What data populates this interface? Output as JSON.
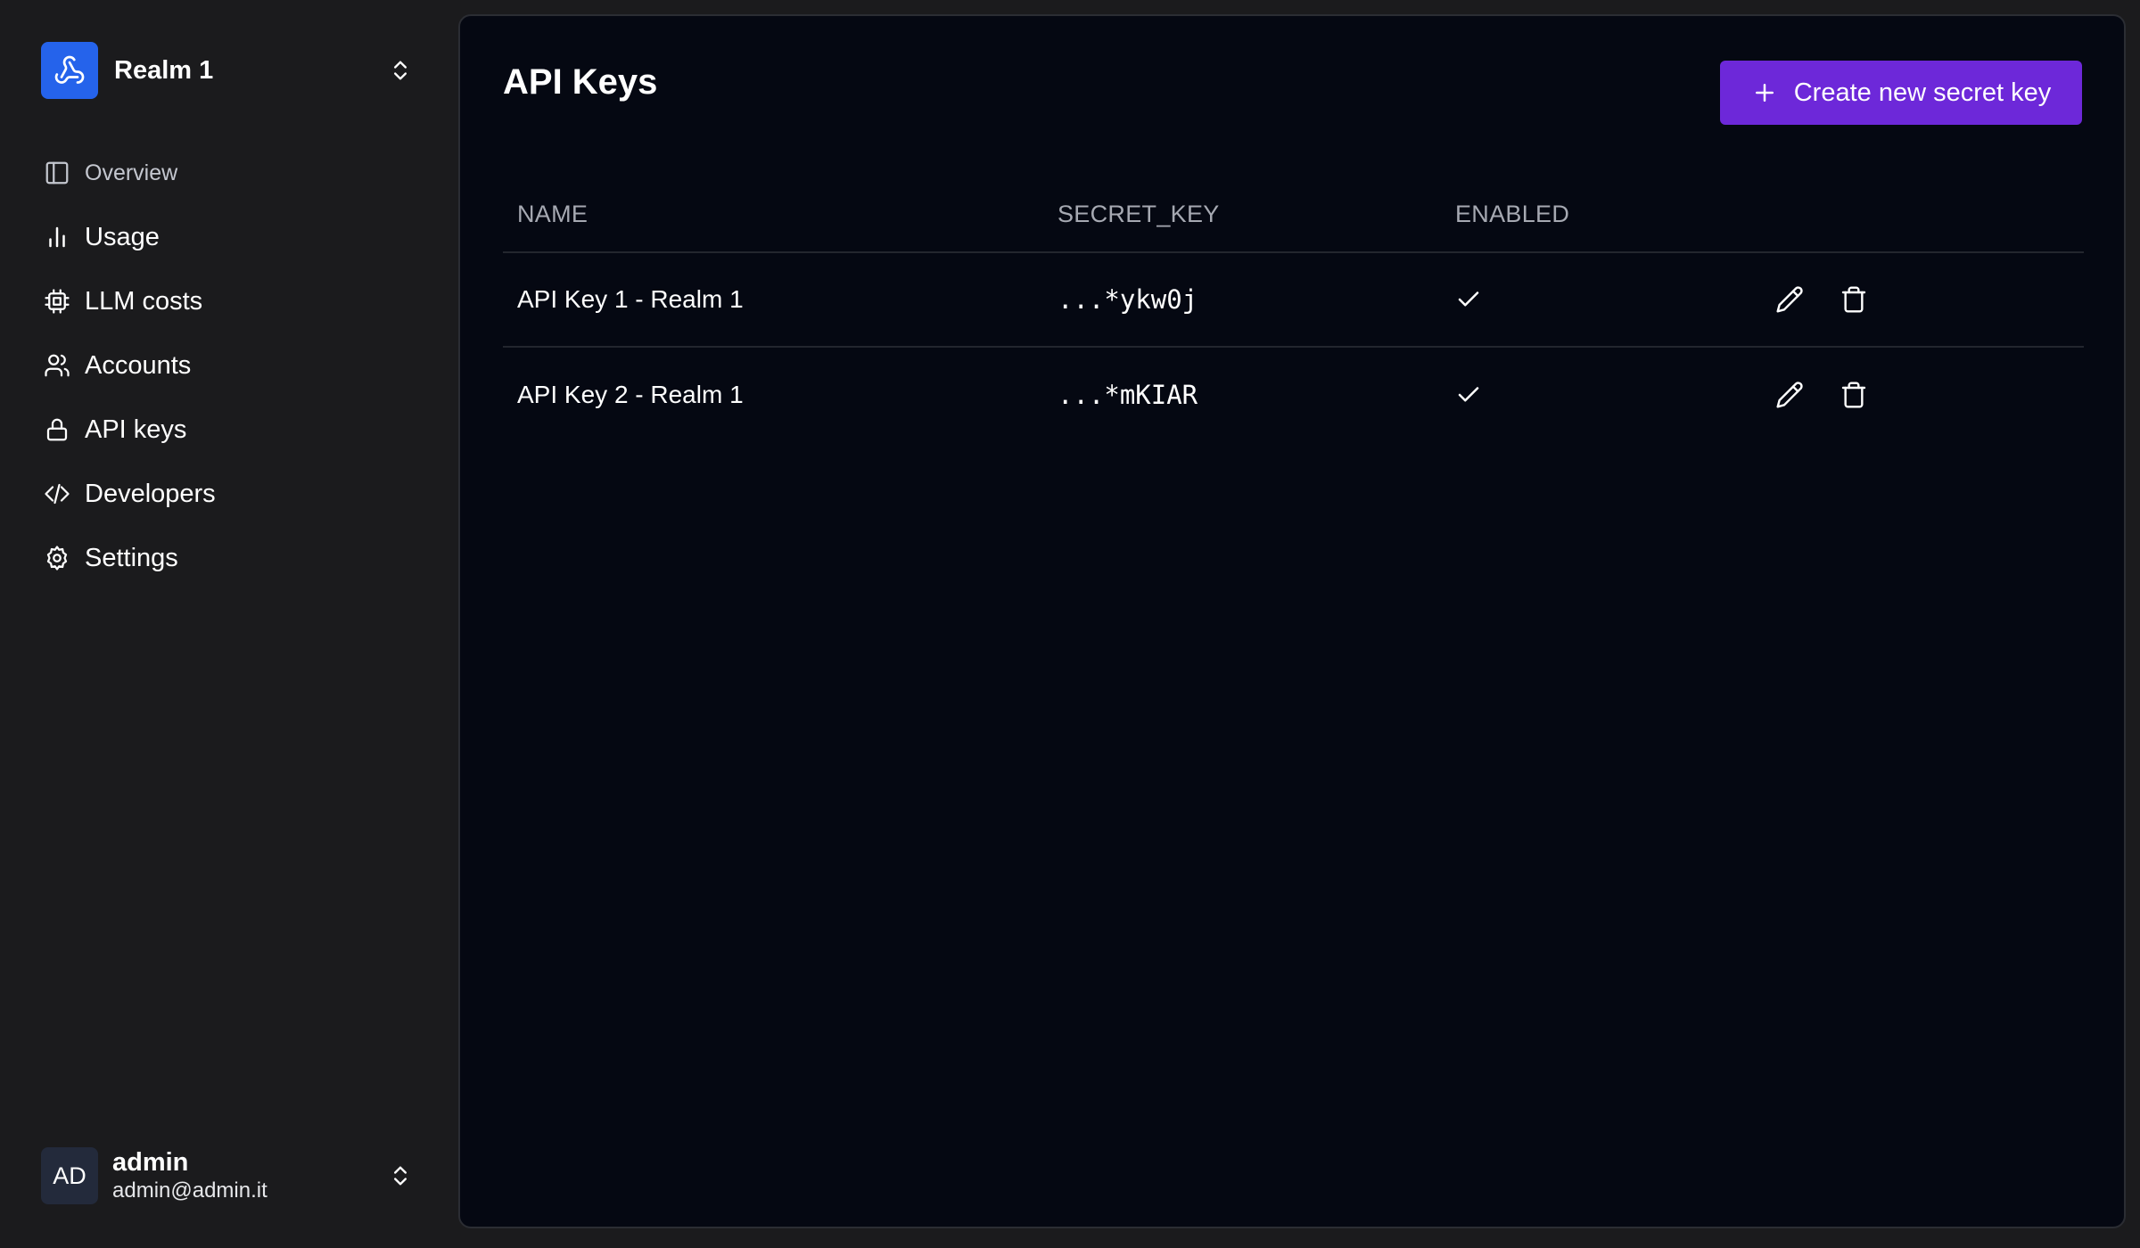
{
  "colors": {
    "background": "#1b1b1d",
    "panel": "#050812",
    "accent": "#6d28d9",
    "realm_logo": "#2563eb"
  },
  "realm": {
    "name": "Realm 1",
    "logo_icon": "webhook-icon",
    "switch_icon": "chevrons-up-down-icon"
  },
  "nav": {
    "items": [
      {
        "label": "Overview",
        "icon": "panel-left-icon"
      },
      {
        "label": "Usage",
        "icon": "bar-chart-icon"
      },
      {
        "label": "LLM costs",
        "icon": "cpu-icon"
      },
      {
        "label": "Accounts",
        "icon": "users-icon"
      },
      {
        "label": "API keys",
        "icon": "lock-icon"
      },
      {
        "label": "Developers",
        "icon": "code-icon"
      },
      {
        "label": "Settings",
        "icon": "gear-icon"
      }
    ]
  },
  "user": {
    "initials": "AD",
    "name": "admin",
    "email": "admin@admin.it"
  },
  "main": {
    "title": "API Keys",
    "create_button_label": "Create new secret key"
  },
  "table": {
    "columns": [
      "NAME",
      "SECRET_KEY",
      "ENABLED"
    ],
    "rows": [
      {
        "name": "API Key 1 - Realm 1",
        "secret_key": "...*ykw0j",
        "enabled": true
      },
      {
        "name": "API Key 2 - Realm 1",
        "secret_key": "...*mKIAR",
        "enabled": true
      }
    ]
  }
}
